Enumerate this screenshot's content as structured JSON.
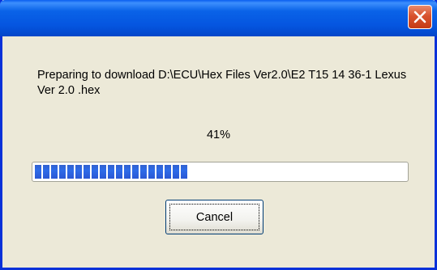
{
  "dialog": {
    "title": "",
    "message": "Preparing to download D:\\ECU\\Hex Files Ver2.0\\E2 T15 14 36-1 Lexus Ver 2.0 .hex",
    "percent_label": "41%",
    "progress": 0.41,
    "cancel_label": "Cancel"
  },
  "colors": {
    "titlebar": "#0a5ef0",
    "progress_chunk": "#2e6be8",
    "close_button": "#d8522e"
  },
  "icons": [
    "close-icon"
  ]
}
